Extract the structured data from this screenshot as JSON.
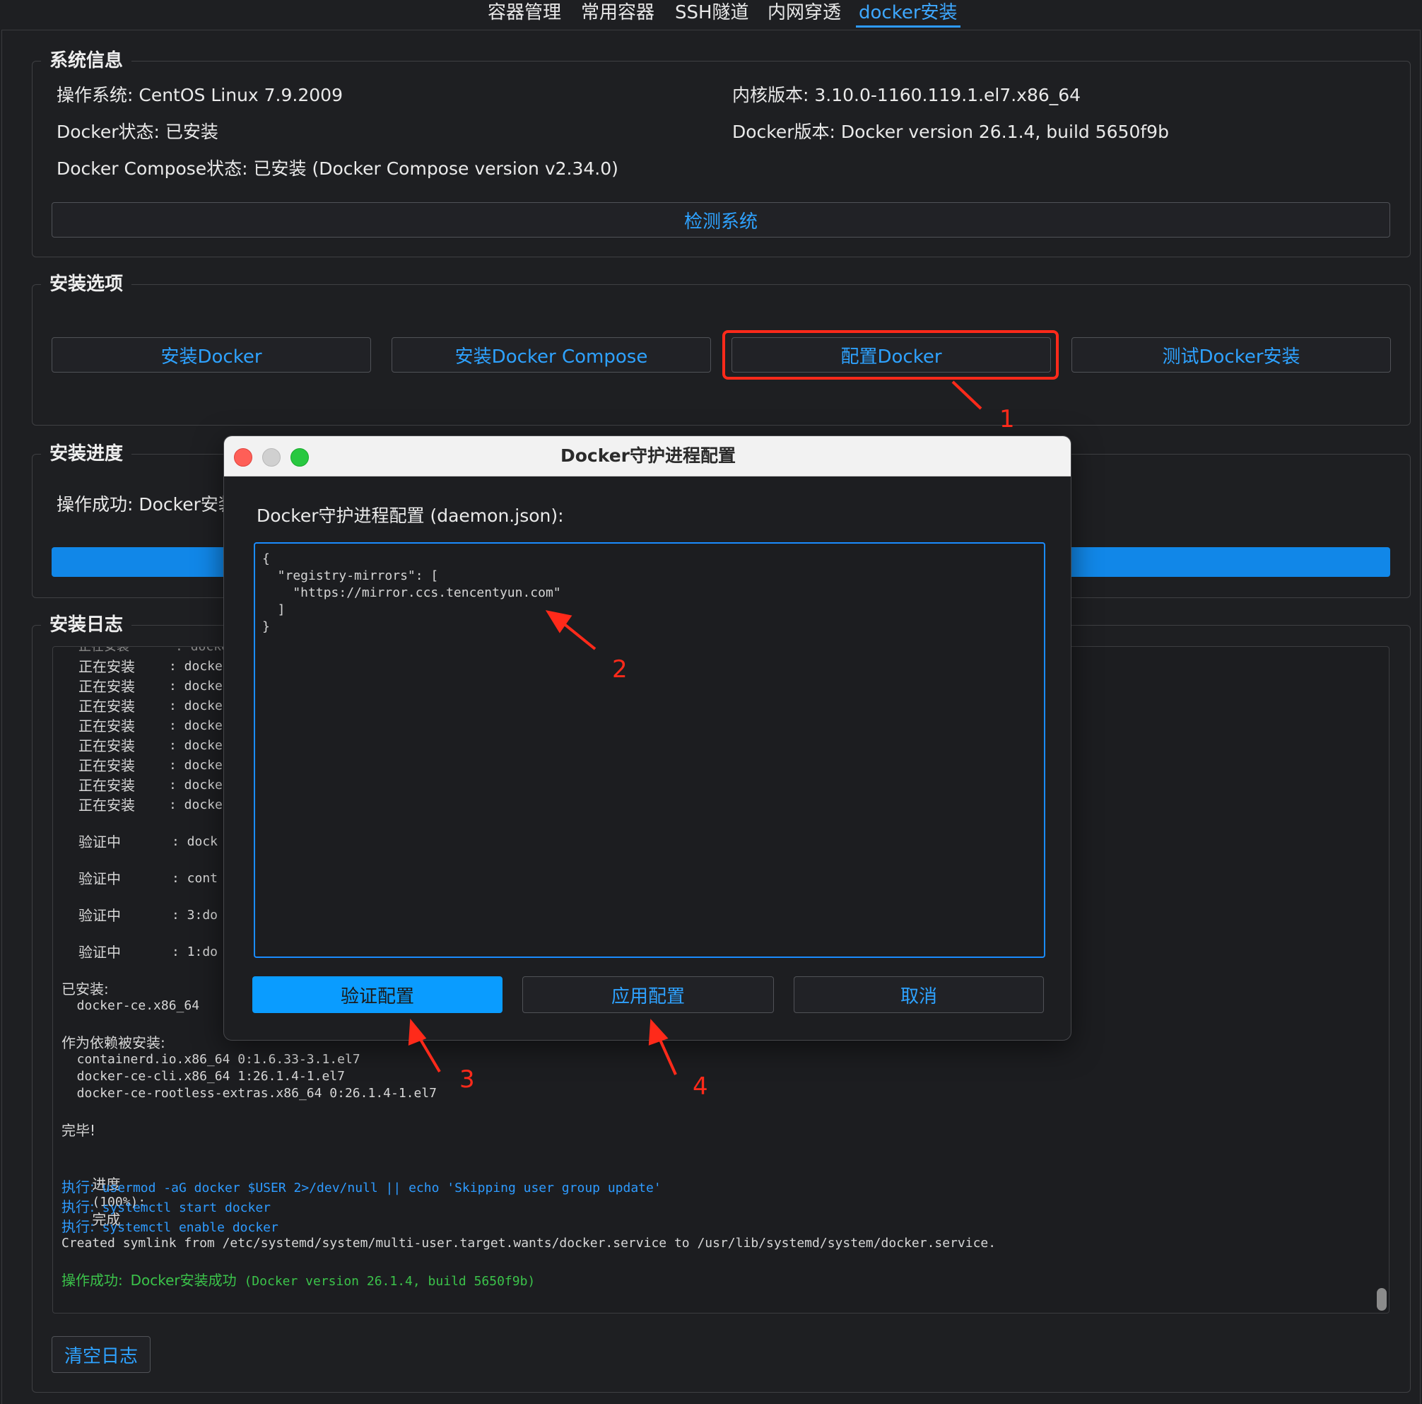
{
  "tabs": [
    "容器管理",
    "常用容器",
    "SSH隧道",
    "内网穿透",
    "docker安装"
  ],
  "active_tab": "docker安装",
  "system_info": {
    "title": "系统信息",
    "os": "操作系统: CentOS Linux 7.9.2009",
    "kernel": "内核版本: 3.10.0-1160.119.1.el7.x86_64",
    "docker_status": "Docker状态: 已安装",
    "docker_version": "Docker版本: Docker version 26.1.4, build 5650f9b",
    "compose_status": "Docker Compose状态: 已安装 (Docker Compose version v2.34.0)",
    "detect_button": "检测系统"
  },
  "install_options": {
    "title": "安装选项",
    "buttons": [
      "安装Docker",
      "安装Docker Compose",
      "配置Docker",
      "测试Docker安装"
    ]
  },
  "progress": {
    "title": "安装进度",
    "status": "操作成功: Docker安装",
    "fraction": 1.0
  },
  "log": {
    "title": "安装日志",
    "lines": [
      {
        "label": "正在安装",
        "text": ": docke"
      },
      {
        "label": "正在安装",
        "text": ": docke"
      },
      {
        "label": "正在安装",
        "text": ": docke"
      },
      {
        "label": "正在安装",
        "text": ": docke"
      },
      {
        "label": "正在安装",
        "text": ": docke"
      },
      {
        "label": "正在安装",
        "text": ": docke"
      },
      {
        "label": "正在安装",
        "text": ": docke"
      },
      {
        "label": "正在安装",
        "text": ": docke"
      },
      {
        "label": "验证中",
        "text": ": dock"
      },
      {
        "label": "验证中",
        "text": ": cont"
      },
      {
        "label": "验证中",
        "text": ": 3:do"
      },
      {
        "label": "验证中",
        "text": ": 1:do"
      }
    ],
    "installed_header": "已安装:",
    "installed_pkg": "  docker-ce.x86_64",
    "deps_header": "作为依赖被安装:",
    "deps": [
      "  containerd.io.x86_64 0:1.6.33-3.1.el7",
      "  docker-ce-cli.x86_64 1:26.1.4-1.el7",
      "  docker-ce-rootless-extras.x86_64 0:26.1.4-1.el7"
    ],
    "done": "完毕!",
    "progress_label": "进度",
    "progress_pct": "(100%):",
    "progress_done": "完成",
    "exec_label": "执行:",
    "exec_cmds": [
      "usermod -aG docker $USER 2>/dev/null || echo 'Skipping user group update'",
      "systemctl start docker",
      "systemctl enable docker"
    ],
    "symlink": "Created symlink from /etc/systemd/system/multi-user.target.wants/docker.service to /usr/lib/systemd/system/docker.service.",
    "success_label": "操作成功:",
    "success_cn": "Docker安装成功",
    "success_detail": "(Docker version 26.1.4, build 5650f9b)",
    "clear_button": "清空日志"
  },
  "dialog": {
    "title": "Docker守护进程配置",
    "label": "Docker守护进程配置 (daemon.json):",
    "code_lines": [
      "{",
      "  \"registry-mirrors\": [",
      "    \"https://mirror.ccs.tencentyun.com\"",
      "  ]",
      "}"
    ],
    "buttons": [
      "验证配置",
      "应用配置",
      "取消"
    ]
  },
  "annotations": [
    "1",
    "2",
    "3",
    "4"
  ],
  "colors": {
    "accent": "#2d9bff",
    "annotation": "#ff2a1a",
    "success": "#3bc34a",
    "background": "#1e1f22"
  }
}
